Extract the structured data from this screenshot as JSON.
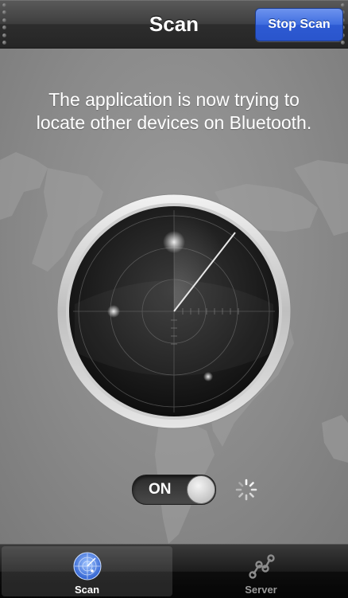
{
  "navbar": {
    "title": "Scan",
    "stop_button": "Stop Scan"
  },
  "message": "The application is now trying to locate other devices on Bluetooth.",
  "toggle": {
    "label": "ON",
    "state": "on"
  },
  "tabs": [
    {
      "label": "Scan",
      "icon": "radar-icon",
      "selected": true
    },
    {
      "label": "Server",
      "icon": "network-nodes-icon",
      "selected": false
    }
  ],
  "colors": {
    "accent": "#2f5fd6",
    "background": "#8a8a8a"
  }
}
